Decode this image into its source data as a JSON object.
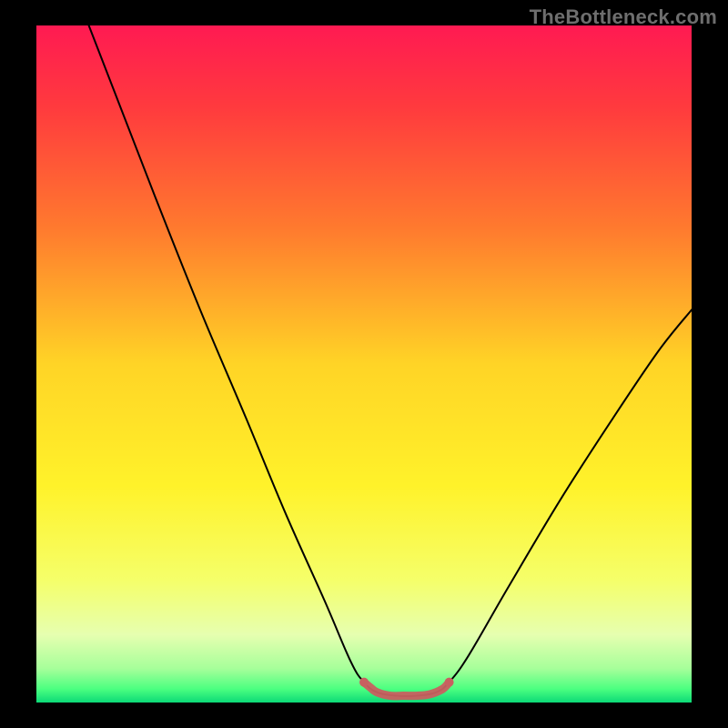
{
  "watermark": "TheBottleneck.com",
  "chart_data": {
    "type": "line",
    "title": "",
    "xlabel": "",
    "ylabel": "",
    "xlim": [
      0,
      100
    ],
    "ylim": [
      0,
      100
    ],
    "background": {
      "type": "vertical-gradient",
      "stops": [
        {
          "offset": 0.0,
          "color": "#ff1a52"
        },
        {
          "offset": 0.12,
          "color": "#ff3a3e"
        },
        {
          "offset": 0.3,
          "color": "#ff7a2e"
        },
        {
          "offset": 0.5,
          "color": "#ffd426"
        },
        {
          "offset": 0.68,
          "color": "#fff22a"
        },
        {
          "offset": 0.82,
          "color": "#f5ff6a"
        },
        {
          "offset": 0.9,
          "color": "#e6ffb0"
        },
        {
          "offset": 0.95,
          "color": "#a6ff9a"
        },
        {
          "offset": 0.98,
          "color": "#4bff80"
        },
        {
          "offset": 1.0,
          "color": "#0cd977"
        }
      ]
    },
    "border": {
      "color": "#000000",
      "width_frac_left_right": 0.05,
      "width_frac_top_bottom": 0.035
    },
    "series": [
      {
        "name": "bottleneck-curve",
        "color": "#000000",
        "stroke_width": 2,
        "points": [
          {
            "x": 8.0,
            "y": 100.0
          },
          {
            "x": 12.0,
            "y": 90.0
          },
          {
            "x": 18.0,
            "y": 75.0
          },
          {
            "x": 25.0,
            "y": 58.0
          },
          {
            "x": 32.0,
            "y": 42.0
          },
          {
            "x": 38.0,
            "y": 28.0
          },
          {
            "x": 44.0,
            "y": 15.0
          },
          {
            "x": 48.0,
            "y": 6.0
          },
          {
            "x": 50.0,
            "y": 3.0
          },
          {
            "x": 52.0,
            "y": 1.5
          },
          {
            "x": 55.0,
            "y": 1.0
          },
          {
            "x": 58.0,
            "y": 1.0
          },
          {
            "x": 61.0,
            "y": 1.5
          },
          {
            "x": 63.0,
            "y": 3.0
          },
          {
            "x": 66.0,
            "y": 7.0
          },
          {
            "x": 72.0,
            "y": 17.0
          },
          {
            "x": 80.0,
            "y": 30.0
          },
          {
            "x": 88.0,
            "y": 42.0
          },
          {
            "x": 95.0,
            "y": 52.0
          },
          {
            "x": 100.0,
            "y": 58.0
          }
        ]
      },
      {
        "name": "optimal-zone-marker",
        "color": "#c86060",
        "stroke_width": 9,
        "stroke_linecap": "round",
        "points": [
          {
            "x": 50.0,
            "y": 3.0
          },
          {
            "x": 51.0,
            "y": 2.2
          },
          {
            "x": 52.0,
            "y": 1.5
          },
          {
            "x": 54.0,
            "y": 1.0
          },
          {
            "x": 56.0,
            "y": 1.0
          },
          {
            "x": 58.0,
            "y": 1.0
          },
          {
            "x": 60.0,
            "y": 1.2
          },
          {
            "x": 62.0,
            "y": 2.0
          },
          {
            "x": 63.0,
            "y": 3.0
          }
        ]
      }
    ]
  }
}
